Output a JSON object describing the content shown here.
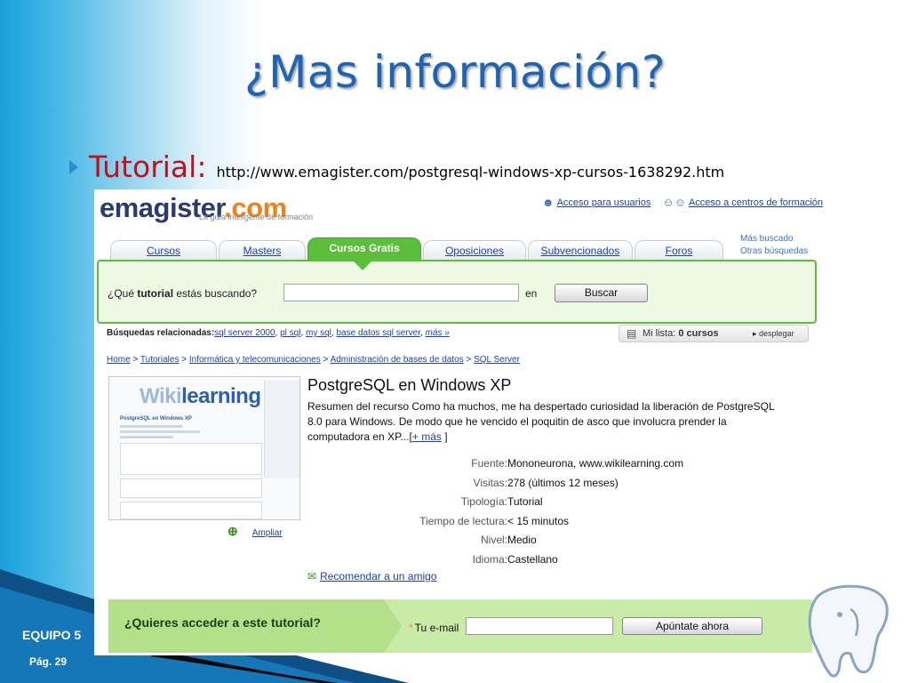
{
  "slide": {
    "title": "¿Mas información?",
    "bullet_label": "Tutorial:",
    "bullet_url": "http://www.emagister.com/postgresql-windows-xp-cursos-1638292.htm",
    "footer_team": "EQUIPO 5",
    "footer_page": "Pág. 29",
    "colors": {
      "title": "#1d64b4",
      "bullet": "#c0101a",
      "accent": "#5bbf3c"
    }
  },
  "site": {
    "logo_main": "emagister",
    "logo_dot": ".",
    "logo_com": "com",
    "logo_tagline": "La guía inteligente de formación",
    "top_links": [
      "Acceso para usuarios",
      "Acceso a centros de formación"
    ],
    "tabs": [
      "Cursos",
      "Masters",
      "Cursos Gratis",
      "Oposiciones",
      "Subvencionados",
      "Foros"
    ],
    "active_tab": "Cursos Gratis",
    "right_links": [
      "Más buscado",
      "Otras búsquedas"
    ],
    "search": {
      "label_pre": "¿Qué ",
      "label_bold": "tutorial",
      "label_post": " estás buscando?",
      "value": "",
      "en": "en",
      "button": "Buscar"
    },
    "related": {
      "label": "Búsquedas relacionadas:",
      "links": [
        "sql server 2000",
        "pl sql",
        "my sql",
        "base datos sql server",
        "más »"
      ]
    },
    "mylist": {
      "label": "Mi lista: ",
      "count": "0 cursos",
      "toggle": "desplegar"
    },
    "breadcrumb": [
      "Home",
      "Tutoriales",
      "Informática y telecomunicaciones",
      "Administración de bases de datos",
      "SQL Server"
    ],
    "thumbnail": {
      "brand_light": "Wiki",
      "brand_dark": "learning",
      "title": "PostgreSQL en Windows XP"
    },
    "ampliar": "Ampliar",
    "result": {
      "title": "PostgreSQL en Windows XP",
      "description": "Resumen del recurso Como ha muchos, me ha despertado curiosidad la liberación de PostgreSQL 8.0 para Windows. De modo que he vencido el poquitin de asco que involucra prender la computadora en XP...[",
      "more_link": "+ más",
      "desc_end": "]",
      "details": [
        {
          "key": "Fuente:",
          "value": "Mononeurona, www.wikilearning.com"
        },
        {
          "key": "Visitas:",
          "value": "278 (últimos 12 meses)"
        },
        {
          "key": "Tipología:",
          "value": "Tutorial"
        },
        {
          "key": "Tiempo de lectura:",
          "value": "< 15 minutos"
        },
        {
          "key": "Nivel:",
          "value": "Medio"
        },
        {
          "key": "Idioma:",
          "value": "Castellano"
        }
      ],
      "recommend": "Recomendar a un amigo"
    },
    "cta": {
      "question": "¿Quieres acceder a este tutorial?",
      "email_star": "*",
      "email_label": "Tu e-mail",
      "email_value": "",
      "button": "Apúntate ahora"
    }
  }
}
